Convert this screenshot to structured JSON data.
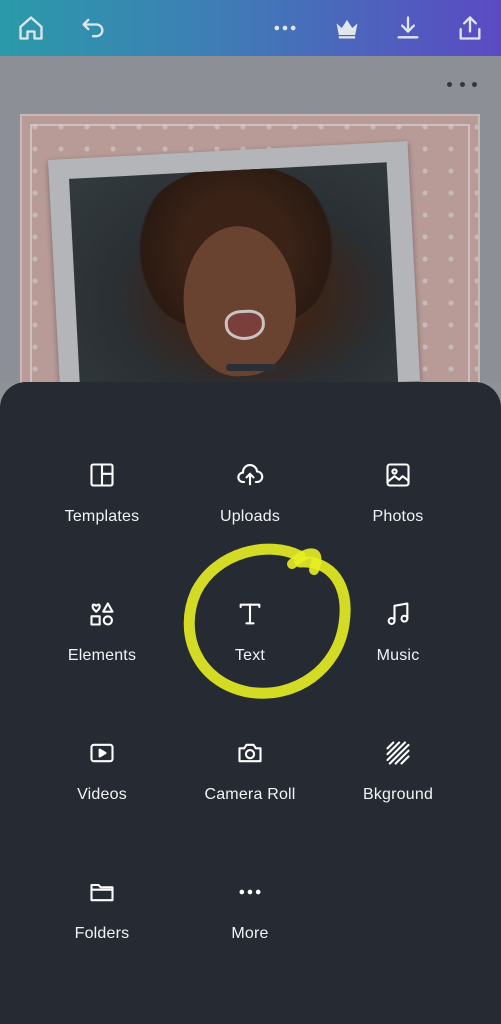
{
  "toolbar": {
    "icons": [
      "home-icon",
      "undo-icon",
      "more-dots-icon",
      "crown-icon",
      "download-icon",
      "share-upload-icon"
    ]
  },
  "canvas": {
    "more_icon": "more-dots-icon"
  },
  "menu": {
    "items": [
      {
        "label": "Templates",
        "icon": "templates-icon"
      },
      {
        "label": "Uploads",
        "icon": "cloud-upload-icon"
      },
      {
        "label": "Photos",
        "icon": "photo-icon"
      },
      {
        "label": "Elements",
        "icon": "elements-shapes-icon"
      },
      {
        "label": "Text",
        "icon": "text-icon"
      },
      {
        "label": "Music",
        "icon": "music-note-icon"
      },
      {
        "label": "Videos",
        "icon": "video-icon"
      },
      {
        "label": "Camera Roll",
        "icon": "camera-icon"
      },
      {
        "label": "Bkground",
        "icon": "background-stripes-icon"
      },
      {
        "label": "Folders",
        "icon": "folder-icon"
      },
      {
        "label": "More",
        "icon": "more-dots-icon"
      }
    ]
  },
  "colors": {
    "toolbar_gradient_start": "#2a9aa9",
    "toolbar_gradient_end": "#5b4ac3",
    "sheet_background": "#262b33",
    "highlight": "#e8ee22"
  }
}
